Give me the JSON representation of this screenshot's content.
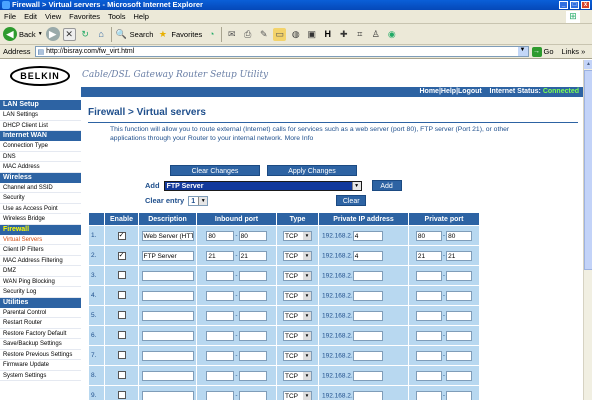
{
  "window": {
    "title": "Firewall > Virtual servers - Microsoft Internet Explorer"
  },
  "menu": [
    "File",
    "Edit",
    "View",
    "Favorites",
    "Tools",
    "Help"
  ],
  "toolbar": {
    "back": "Back",
    "search": "Search",
    "favorites": "Favorites"
  },
  "address": {
    "label": "Address",
    "url": "http://bisray.com/fw_virt.html",
    "go": "Go",
    "links": "Links"
  },
  "header": {
    "logo": "BELKIN",
    "subtitle": "Cable/DSL Gateway Router Setup Utility",
    "nav": "Home|Help|Logout",
    "internet_status_label": "Internet Status:",
    "internet_status_value": "Connected"
  },
  "sidebar": {
    "sections": [
      {
        "title": "LAN Setup",
        "items": [
          "LAN Settings",
          "DHCP Client List"
        ]
      },
      {
        "title": "Internet WAN",
        "items": [
          "Connection Type",
          "DNS",
          "MAC Address"
        ]
      },
      {
        "title": "Wireless",
        "items": [
          "Channel and SSID",
          "Security",
          "Use as Access Point",
          "Wireless Bridge"
        ]
      },
      {
        "title": "Firewall",
        "items": [
          "Virtual Servers",
          "Client IP Filters",
          "MAC Address Filtering",
          "DMZ",
          "WAN Ping Blocking",
          "Security Log"
        ]
      },
      {
        "title": "Utilities",
        "items": [
          "Parental Control",
          "Restart Router",
          "Restore Factory Default",
          "Save/Backup Settings",
          "Restore Previous Settings",
          "Firmware Update",
          "System Settings"
        ]
      }
    ]
  },
  "main": {
    "title": "Firewall > Virtual servers",
    "intro": "This function will allow you to route external (Internet) calls for services such as a web server (port 80), FTP server (Port 21), or other applications through your Router to your internal network.",
    "more_info": "More Info",
    "clear_changes": "Clear Changes",
    "apply_changes": "Apply Changes",
    "add_label": "Add",
    "add_selected": "FTP Server",
    "add_button": "Add",
    "clear_entry_label": "Clear entry",
    "clear_entry_value": "1",
    "clear_button": "Clear"
  },
  "table": {
    "headers": [
      "Enable",
      "Description",
      "Inbound port",
      "Type",
      "Private IP address",
      "Private port"
    ],
    "ip_prefix": "192.168.2.",
    "rows": [
      {
        "num": "1.",
        "checked": true,
        "desc": "Web Server (HTTP)",
        "in1": "80",
        "in2": "80",
        "type": "TCP",
        "ip": "4",
        "p1": "80",
        "p2": "80"
      },
      {
        "num": "2.",
        "checked": true,
        "desc": "FTP Server",
        "in1": "21",
        "in2": "21",
        "type": "TCP",
        "ip": "4",
        "p1": "21",
        "p2": "21"
      },
      {
        "num": "3.",
        "checked": false,
        "desc": "",
        "in1": "",
        "in2": "",
        "type": "TCP",
        "ip": "",
        "p1": "",
        "p2": ""
      },
      {
        "num": "4.",
        "checked": false,
        "desc": "",
        "in1": "",
        "in2": "",
        "type": "TCP",
        "ip": "",
        "p1": "",
        "p2": ""
      },
      {
        "num": "5.",
        "checked": false,
        "desc": "",
        "in1": "",
        "in2": "",
        "type": "TCP",
        "ip": "",
        "p1": "",
        "p2": ""
      },
      {
        "num": "6.",
        "checked": false,
        "desc": "",
        "in1": "",
        "in2": "",
        "type": "TCP",
        "ip": "",
        "p1": "",
        "p2": ""
      },
      {
        "num": "7.",
        "checked": false,
        "desc": "",
        "in1": "",
        "in2": "",
        "type": "TCP",
        "ip": "",
        "p1": "",
        "p2": ""
      },
      {
        "num": "8.",
        "checked": false,
        "desc": "",
        "in1": "",
        "in2": "",
        "type": "TCP",
        "ip": "",
        "p1": "",
        "p2": ""
      },
      {
        "num": "9.",
        "checked": false,
        "desc": "",
        "in1": "",
        "in2": "",
        "type": "TCP",
        "ip": "",
        "p1": "",
        "p2": ""
      }
    ]
  }
}
